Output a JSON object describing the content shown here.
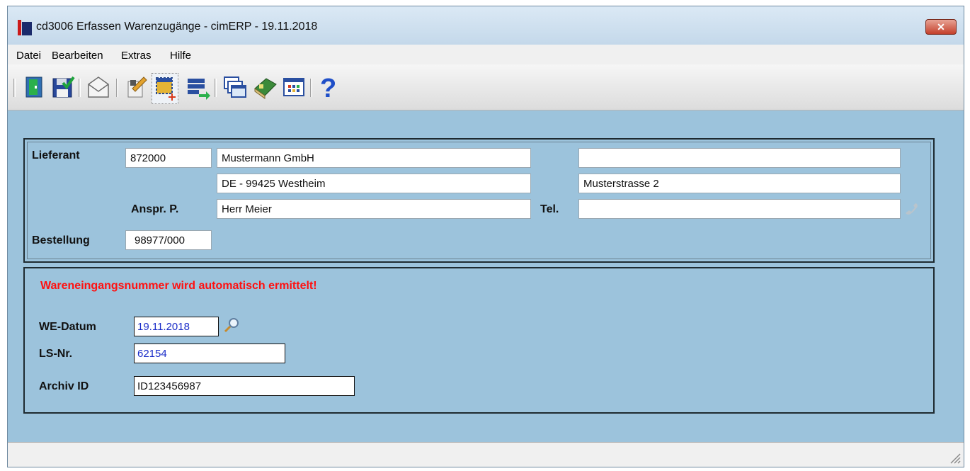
{
  "window": {
    "title": "cd3006 Erfassen Warenzugänge - cimERP - 19.11.2018",
    "close_label": "✕"
  },
  "menu": [
    "Datei",
    "Bearbeiten",
    "Extras",
    "Hilfe"
  ],
  "toolbar": {
    "icons": [
      "exit-door-icon",
      "save-check-icon",
      "mail-envelope-icon",
      "edit-document-icon",
      "new-record-icon",
      "transfer-list-icon",
      "windows-icon",
      "book-icon",
      "table-grid-icon",
      "help-question-icon"
    ],
    "selected": "new-record-icon"
  },
  "supplier": {
    "label": "Lieferant",
    "number": "872000",
    "name": "Mustermann GmbH",
    "name2": "",
    "city": "DE - 99425 Westheim",
    "street": "Musterstrasse 2",
    "contact_label": "Anspr. P.",
    "contact": "Herr Meier",
    "phone_label": "Tel.",
    "phone": ""
  },
  "order": {
    "label": "Bestellung",
    "number": "98977/000"
  },
  "receipt": {
    "warning": "Wareneingangsnummer wird automatisch ermittelt!",
    "date_label": "WE-Datum",
    "date": "19.11.2018",
    "ls_label": "LS-Nr.",
    "ls": "62154",
    "archive_label": "Archiv ID",
    "archive": "ID123456987"
  },
  "colors": {
    "accent_red": "#ff1010",
    "field_text_blue": "#1a2cc8",
    "window_bg": "#9cc3dc"
  }
}
